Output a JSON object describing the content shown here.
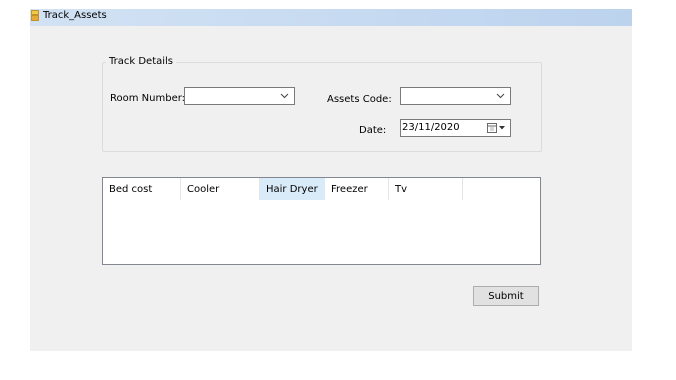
{
  "window": {
    "title": "Track_Assets"
  },
  "group": {
    "label": "Track Details"
  },
  "fields": {
    "room_number_label": "Room Number:",
    "room_number_value": "",
    "assets_code_label": "Assets Code:",
    "assets_code_value": "",
    "date_label": "Date:",
    "date_value": "23/11/2020"
  },
  "list": {
    "columns": [
      "Bed cost",
      "Cooler",
      "Hair Dryer",
      "Freezer",
      "Tv"
    ]
  },
  "actions": {
    "submit_label": "Submit"
  },
  "icons": {
    "app": "app-icon",
    "dropdown": "chevron-down-icon",
    "calendar": "calendar-icon"
  }
}
